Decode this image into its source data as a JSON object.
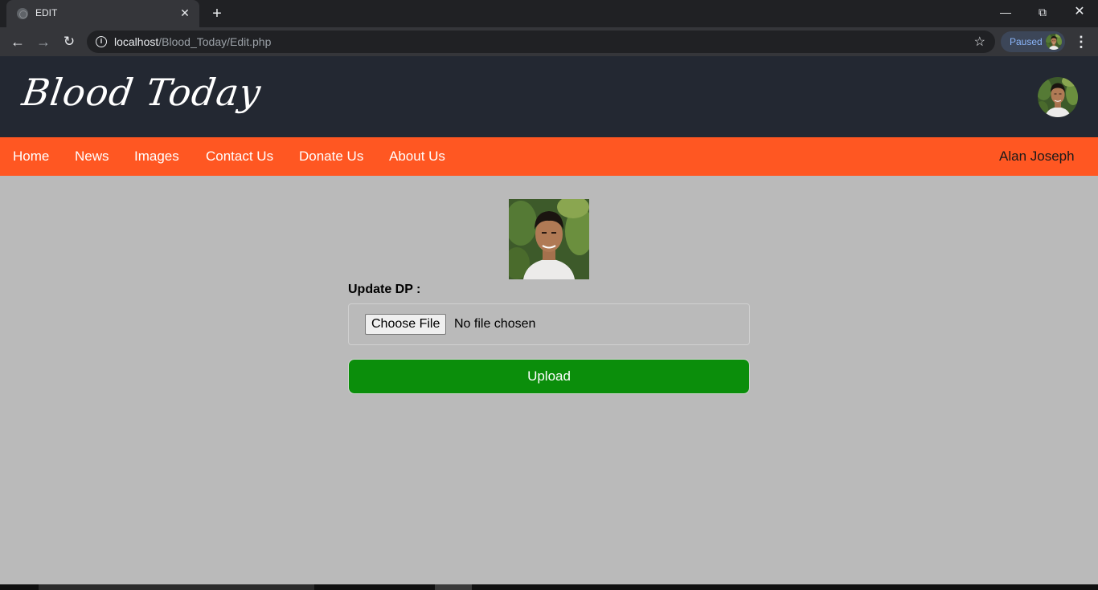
{
  "browser": {
    "tab_title": "EDIT",
    "url_host": "localhost",
    "url_path": "/Blood_Today/Edit.php",
    "profile_status": "Paused"
  },
  "header": {
    "logo_text": "Blood Today"
  },
  "nav": {
    "items": [
      "Home",
      "News",
      "Images",
      "Contact Us",
      "Donate Us",
      "About Us"
    ],
    "user_name": "Alan Joseph"
  },
  "form": {
    "dp_label": "Update DP :",
    "choose_file_label": "Choose File",
    "file_status": "No file chosen",
    "upload_label": "Upload"
  },
  "colors": {
    "header_bg": "#232832",
    "nav_bg": "#ff5722",
    "page_bg": "#bababa",
    "upload_bg": "#0b8e0b"
  },
  "icons": {
    "back": "arrow-left-icon",
    "forward": "arrow-right-icon",
    "reload": "reload-icon",
    "info": "info-icon",
    "bookmark": "star-icon",
    "menu": "kebab-menu-icon"
  }
}
